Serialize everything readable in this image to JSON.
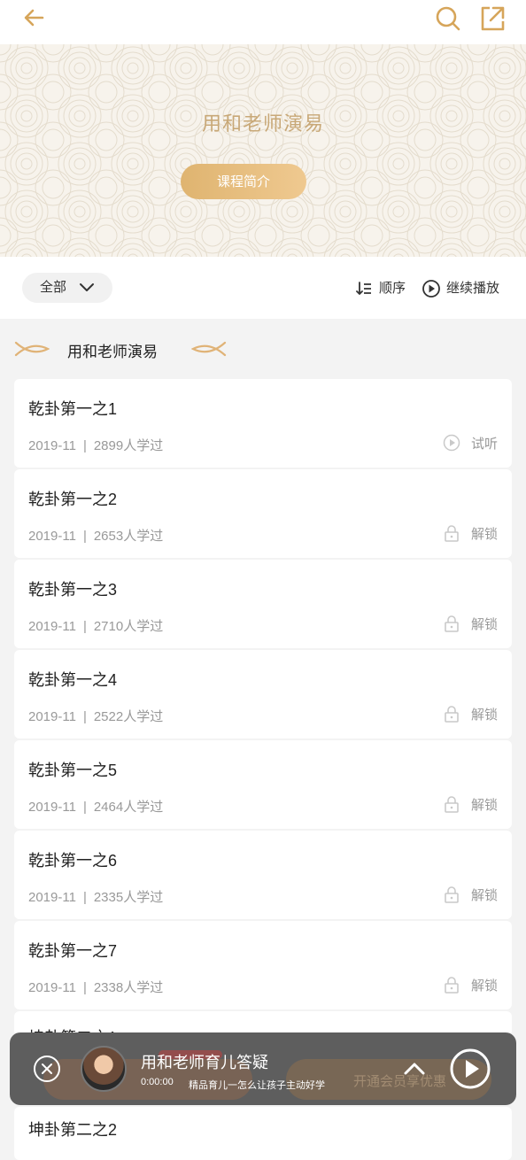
{
  "header": {
    "back_icon": "arrow-left-icon",
    "search_icon": "search-icon",
    "share_icon": "share-external-icon",
    "accent": "#d6a55a"
  },
  "hero": {
    "title": "用和老师演易",
    "intro_button": "课程简介"
  },
  "filter": {
    "all_label": "全部",
    "order_label": "顺序",
    "continue_label": "继续播放"
  },
  "section": {
    "title": "用和老师演易"
  },
  "lessons": [
    {
      "title": "乾卦第一之1",
      "date": "2019-11",
      "learners": "2899人学过",
      "action": "试听",
      "action_icon": "play-circle-icon"
    },
    {
      "title": "乾卦第一之2",
      "date": "2019-11",
      "learners": "2653人学过",
      "action": "解锁",
      "action_icon": "lock-icon"
    },
    {
      "title": "乾卦第一之3",
      "date": "2019-11",
      "learners": "2710人学过",
      "action": "解锁",
      "action_icon": "lock-icon"
    },
    {
      "title": "乾卦第一之4",
      "date": "2019-11",
      "learners": "2522人学过",
      "action": "解锁",
      "action_icon": "lock-icon"
    },
    {
      "title": "乾卦第一之5",
      "date": "2019-11",
      "learners": "2464人学过",
      "action": "解锁",
      "action_icon": "lock-icon"
    },
    {
      "title": "乾卦第一之6",
      "date": "2019-11",
      "learners": "2335人学过",
      "action": "解锁",
      "action_icon": "lock-icon"
    },
    {
      "title": "乾卦第一之7",
      "date": "2019-11",
      "learners": "2338人学过",
      "action": "解锁",
      "action_icon": "lock-icon"
    }
  ],
  "partial_lessons": [
    {
      "title": "坤卦第二之1"
    },
    {
      "title": "坤卦第二之2"
    }
  ],
  "player": {
    "title": "用和老师育儿答疑",
    "time": "0:00:00",
    "subtitle": "精品育儿一怎么让孩子主动好学",
    "behind_text": "开通会员享优惠"
  }
}
